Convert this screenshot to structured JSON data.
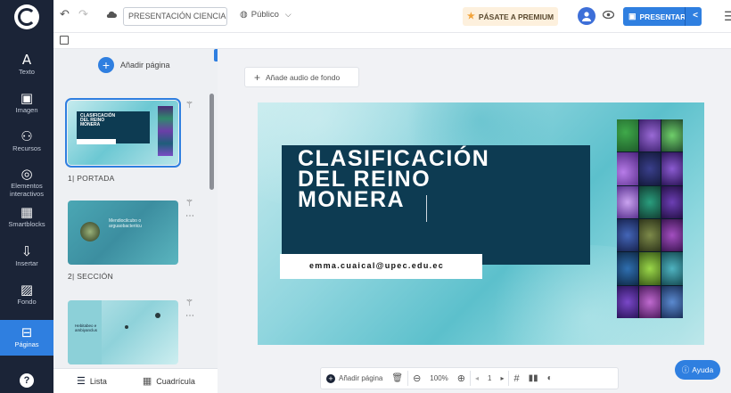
{
  "rail": {
    "items": [
      {
        "label": "Texto",
        "icon": "A"
      },
      {
        "label": "Imagen",
        "icon": "▣"
      },
      {
        "label": "Recursos",
        "icon": "⚇"
      },
      {
        "label": "Elementos interactivos",
        "icon": "◎"
      },
      {
        "label": "Smartblocks",
        "icon": "▦"
      },
      {
        "label": "Insertar",
        "icon": "⇩"
      },
      {
        "label": "Fondo",
        "icon": "▨"
      },
      {
        "label": "Páginas",
        "icon": "⊟"
      }
    ],
    "help_icon": "?"
  },
  "topbar": {
    "undo": "↶",
    "redo": "↷",
    "doc_title": "PRESENTACIÓN CIENCIA...",
    "visibility": "Público",
    "premium_label": "PÁSATE A PREMIUM",
    "present_label": "PRESENTAR"
  },
  "panel": {
    "add_page": "Añadir página",
    "pages": [
      {
        "label": "1| PORTADA"
      },
      {
        "label": "2| SECCIÓN"
      },
      {
        "label": ""
      }
    ],
    "thumb2_text": "Mendiocilcubo o arguaobacteriicu",
    "thumb3_text": "Hebitabeo e ambiyanclus",
    "view_list": "Lista",
    "view_grid": "Cuadrícula"
  },
  "canvas": {
    "audio_label": "Añade audio de fondo",
    "slide_title": "CLASIFICACIÓN\nDEL REINO\nMONERA",
    "slide_email": "emma.cuaical@upec.edu.ec"
  },
  "bottom": {
    "add_page": "Añadir página",
    "zoom": "100%",
    "page_num": "1"
  },
  "help_label": "Ayuda",
  "colors": {
    "rail_bg": "#1b2437",
    "accent": "#2f7fe0",
    "slide_block": "#0d3b52"
  }
}
